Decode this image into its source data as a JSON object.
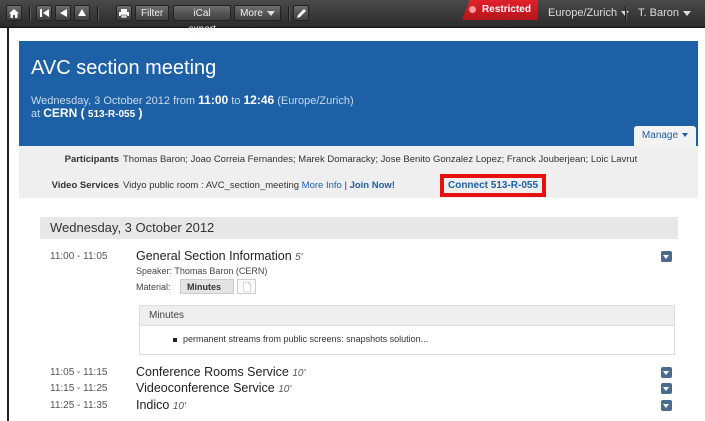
{
  "toolbar": {
    "filter_label": "Filter",
    "ical_label": "iCal export",
    "more_label": "More",
    "restricted_label": "Restricted",
    "timezone": "Europe/Zurich",
    "user": "T. Baron"
  },
  "event": {
    "title": "AVC section meeting",
    "date_prefix": "Wednesday, 3 October 2012 from ",
    "start": "11:00",
    "to": " to ",
    "end": "12:46",
    "tz": " (Europe/Zurich)",
    "at": "at ",
    "location": "CERN",
    "room": "513-R-055",
    "manage_label": "Manage"
  },
  "info": {
    "participants_label": "Participants",
    "participants": "Thomas Baron; Joao Correia Fernandes; Marek Domaracky; Jose Benito Gonzalez Lopez; Franck Jouberjean; Loic Lavrut",
    "video_label": "Video Services",
    "video_text": "Vidyo public room : AVC_section_meeting ",
    "more_info": "More Info",
    "divider": " | ",
    "join_now": "Join Now!",
    "connect": "Connect 513-R-055"
  },
  "day_header": "Wednesday, 3 October 2012",
  "contributions": [
    {
      "time": "11:00 - 11:05",
      "title": "General Section Information",
      "duration": "5'"
    },
    {
      "time": "11:05 - 11:15",
      "title": "Conference Rooms Service",
      "duration": "10'"
    },
    {
      "time": "11:15 - 11:25",
      "title": "Videoconference Service",
      "duration": "10'"
    },
    {
      "time": "11:25 - 11:35",
      "title": "Indico",
      "duration": "10'"
    }
  ],
  "details": {
    "speaker_label": "Speaker:",
    "speaker": "Thomas Baron (CERN)",
    "material_label": "Material:",
    "minutes_button": "Minutes"
  },
  "minutes": {
    "heading": "Minutes",
    "item": "permanent streams from public screens: snapshots solution..."
  },
  "colors": {
    "header_blue": "#1d60a6",
    "restricted_red": "#e2212b",
    "highlight_red": "#e8100e"
  }
}
